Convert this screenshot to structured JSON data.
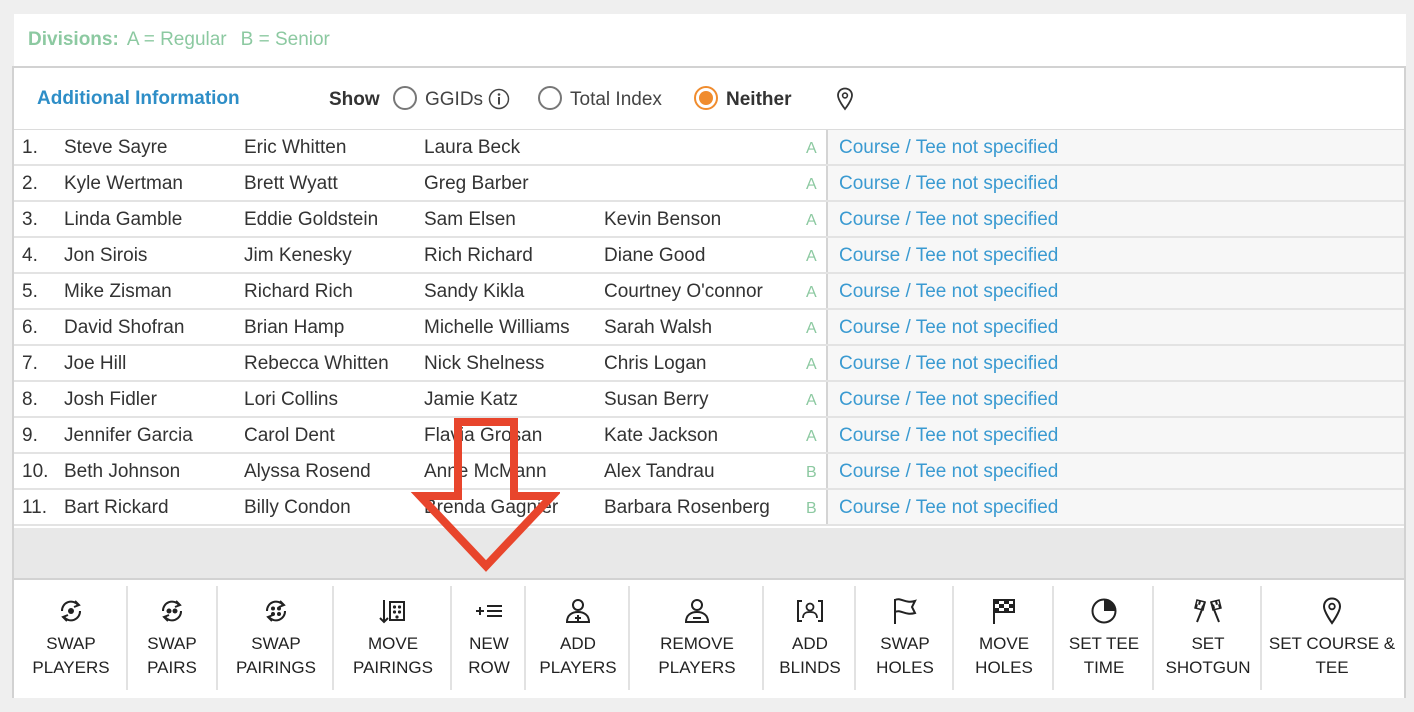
{
  "divisions": {
    "label": "Divisions:",
    "a": "A = Regular",
    "b": "B = Senior"
  },
  "additional_info": {
    "title": "Additional Information",
    "show_label": "Show",
    "options": [
      "GGIDs",
      "Total Index",
      "Neither"
    ],
    "selected": "Neither"
  },
  "pairings": [
    {
      "num": "1.",
      "players": [
        "Steve Sayre",
        "Eric Whitten",
        "Laura Beck",
        ""
      ],
      "division": "A",
      "course": "Course / Tee not specified"
    },
    {
      "num": "2.",
      "players": [
        "Kyle Wertman",
        "Brett Wyatt",
        "Greg Barber",
        ""
      ],
      "division": "A",
      "course": "Course / Tee not specified"
    },
    {
      "num": "3.",
      "players": [
        "Linda Gamble",
        "Eddie Goldstein",
        "Sam Elsen",
        "Kevin Benson"
      ],
      "division": "A",
      "course": "Course / Tee not specified"
    },
    {
      "num": "4.",
      "players": [
        "Jon Sirois",
        "Jim Kenesky",
        "Rich Richard",
        "Diane Good"
      ],
      "division": "A",
      "course": "Course / Tee not specified"
    },
    {
      "num": "5.",
      "players": [
        "Mike Zisman",
        "Richard Rich",
        "Sandy Kikla",
        "Courtney O'connor"
      ],
      "division": "A",
      "course": "Course / Tee not specified"
    },
    {
      "num": "6.",
      "players": [
        "David Shofran",
        "Brian Hamp",
        "Michelle Williams",
        "Sarah Walsh"
      ],
      "division": "A",
      "course": "Course / Tee not specified"
    },
    {
      "num": "7.",
      "players": [
        "Joe Hill",
        "Rebecca Whitten",
        "Nick Shelness",
        "Chris Logan"
      ],
      "division": "A",
      "course": "Course / Tee not specified"
    },
    {
      "num": "8.",
      "players": [
        "Josh Fidler",
        "Lori Collins",
        "Jamie Katz",
        "Susan Berry"
      ],
      "division": "A",
      "course": "Course / Tee not specified"
    },
    {
      "num": "9.",
      "players": [
        "Jennifer Garcia",
        "Carol Dent",
        "Flavia Grosan",
        "Kate Jackson"
      ],
      "division": "A",
      "course": "Course / Tee not specified"
    },
    {
      "num": "10.",
      "players": [
        "Beth Johnson",
        "Alyssa Rosend",
        "Anne McMann",
        "Alex Tandrau"
      ],
      "division": "B",
      "course": "Course / Tee not specified"
    },
    {
      "num": "11.",
      "players": [
        "Bart Rickard",
        "Billy Condon",
        "Brenda Gagnier",
        "Barbara Rosenberg"
      ],
      "division": "B",
      "course": "Course / Tee not specified"
    }
  ],
  "toolbar": [
    {
      "line1": "SWAP",
      "line2": "PLAYERS",
      "icon": "swap-players-icon"
    },
    {
      "line1": "SWAP",
      "line2": "PAIRS",
      "icon": "swap-pairs-icon"
    },
    {
      "line1": "SWAP",
      "line2": "PAIRINGS",
      "icon": "swap-pairings-icon"
    },
    {
      "line1": "MOVE",
      "line2": "PAIRINGS",
      "icon": "move-pairings-icon"
    },
    {
      "line1": "NEW",
      "line2": "ROW",
      "icon": "new-row-icon"
    },
    {
      "line1": "ADD",
      "line2": "PLAYERS",
      "icon": "add-player-icon"
    },
    {
      "line1": "REMOVE",
      "line2": "PLAYERS",
      "icon": "remove-player-icon"
    },
    {
      "line1": "ADD",
      "line2": "BLINDS",
      "icon": "add-blinds-icon"
    },
    {
      "line1": "SWAP",
      "line2": "HOLES",
      "icon": "swap-holes-flag-icon"
    },
    {
      "line1": "MOVE",
      "line2": "HOLES",
      "icon": "move-holes-flag-icon"
    },
    {
      "line1": "SET TEE",
      "line2": "TIME",
      "icon": "clock-icon"
    },
    {
      "line1": "SET",
      "line2": "SHOTGUN",
      "icon": "checkered-flags-icon"
    },
    {
      "line1": "SET COURSE &",
      "line2": "TEE",
      "icon": "map-pin-icon"
    }
  ],
  "colors": {
    "accent_orange": "#f08c2e",
    "link_blue": "#3a9ad1",
    "division_green": "#8cc9a1",
    "annotation_arrow": "#e8452c"
  }
}
